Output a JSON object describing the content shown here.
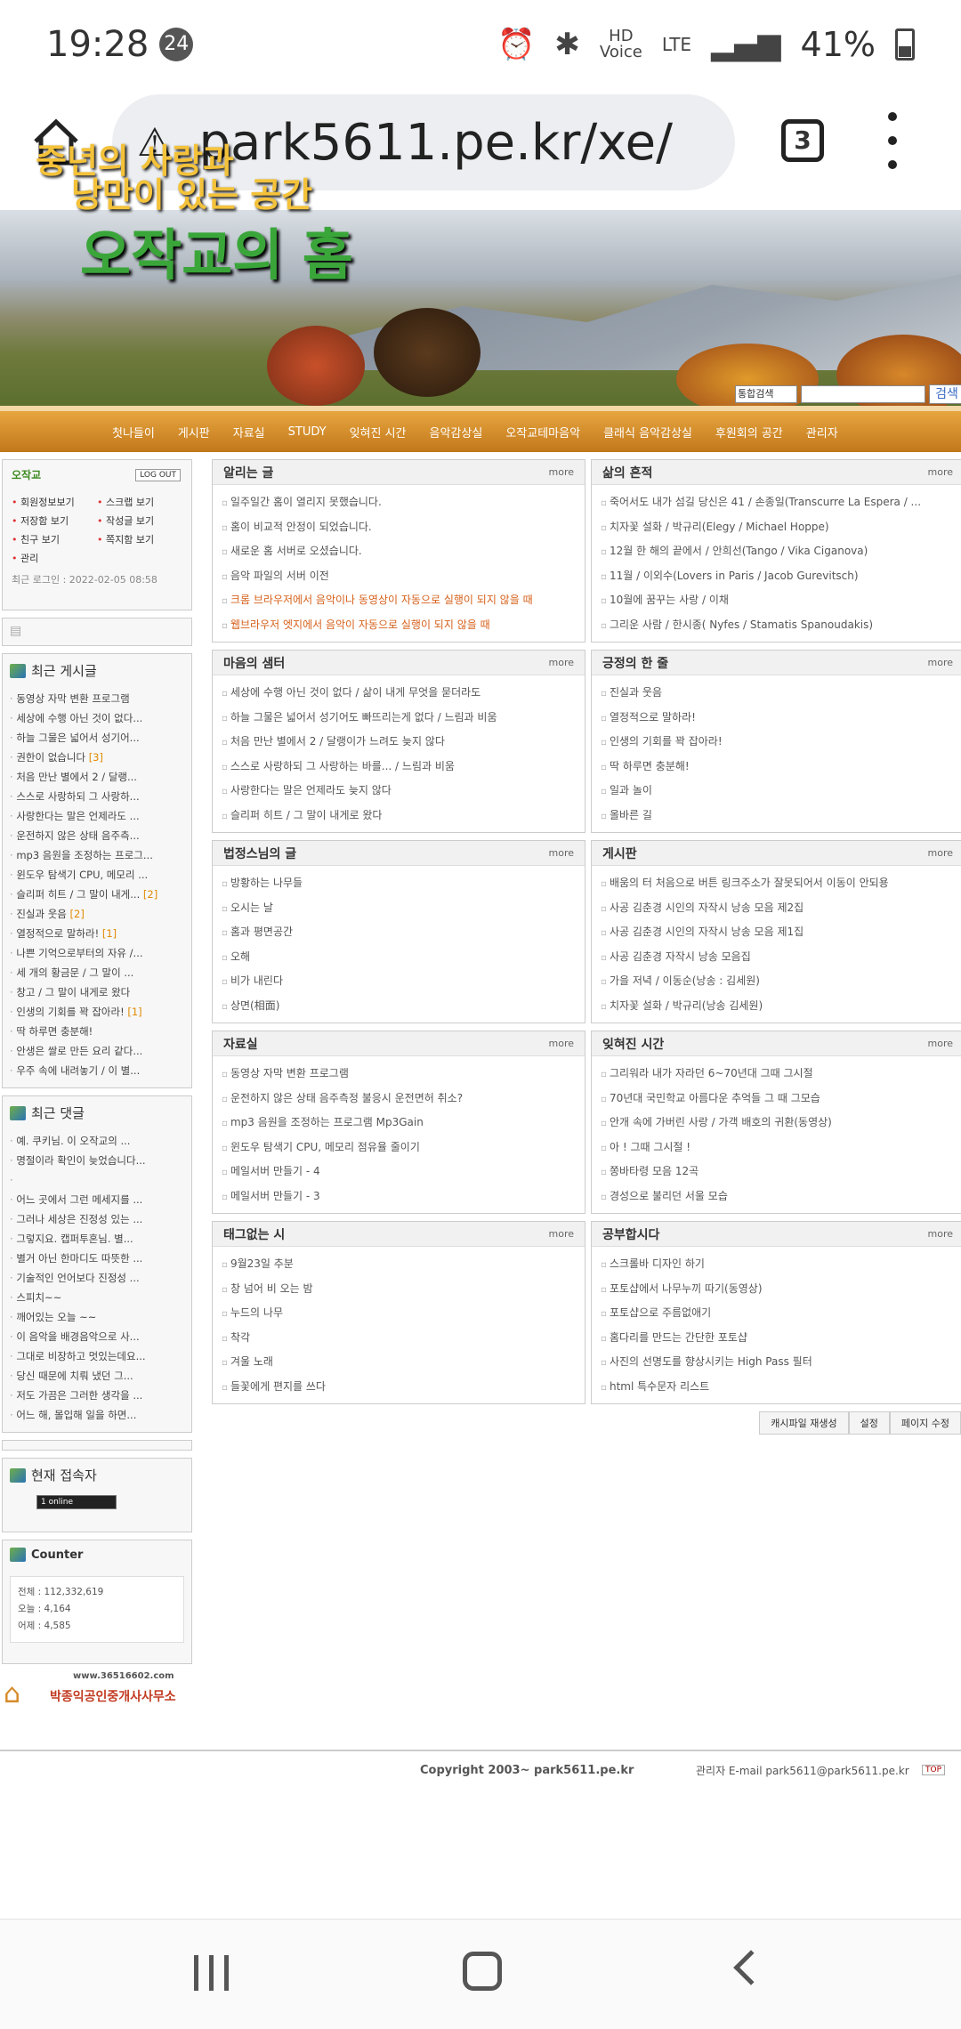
{
  "status": {
    "time": "19:28",
    "notif_count": "24",
    "net_label": "HD",
    "net_sub": "Voice",
    "lte": "LTE",
    "battery": "41%"
  },
  "browser": {
    "url": "park5611.pe.kr/xe/",
    "tabs": "3"
  },
  "banner": {
    "line1": "중년의 사랑과",
    "line2": "낭만이 있는 공간",
    "line3": "오작교의 홈",
    "search_select": "통합검색",
    "search_button": "검색"
  },
  "menu": [
    "첫나들이",
    "게시판",
    "자료실",
    "STUDY",
    "잊혀진 시간",
    "음악감상실",
    "오작교테마음악",
    "클래식 음악감상실",
    "후원회의 공간",
    "관리자"
  ],
  "login": {
    "name": "오작교",
    "logout": "LOG OUT",
    "links": [
      "회원정보보기",
      "스크랩 보기",
      "저장함 보기",
      "작성글 보기",
      "친구 보기",
      "쪽지함 보기",
      "관리"
    ],
    "last_login": "최근 로그인 : 2022-02-05 08:58"
  },
  "recent_posts": {
    "title": "최근 게시글",
    "items": [
      {
        "text": "동영상 자막 변환 프로그램",
        "count": ""
      },
      {
        "text": "세상에 수행 아닌 것이 없다...",
        "count": ""
      },
      {
        "text": "하늘 그물은 넓어서 성기어...",
        "count": ""
      },
      {
        "text": "권한이 없습니다",
        "count": "[3]"
      },
      {
        "text": "처음 만난 별에서 2 / 달랭...",
        "count": ""
      },
      {
        "text": "스스로 사랑하되 그 사랑하...",
        "count": ""
      },
      {
        "text": "사랑한다는 말은 언제라도 ...",
        "count": ""
      },
      {
        "text": "운전하지 않은 상태 음주측...",
        "count": ""
      },
      {
        "text": "mp3 음원을 조정하는 프로그...",
        "count": ""
      },
      {
        "text": "윈도우 탐색기 CPU, 메모리 ...",
        "count": ""
      },
      {
        "text": "슬리퍼 히트 / 그 말이 내게...",
        "count": "[2]"
      },
      {
        "text": "진실과 웃음",
        "count": "[2]"
      },
      {
        "text": "열정적으로 말하라!",
        "count": "[1]"
      },
      {
        "text": "나쁜 기억으로부터의 자유 /...",
        "count": ""
      },
      {
        "text": "세 개의 황금문 / 그 말이 ...",
        "count": ""
      },
      {
        "text": "창고 / 그 말이 내게로 왔다",
        "count": ""
      },
      {
        "text": "인생의 기회를 꽉 잡아라!",
        "count": "[1]"
      },
      {
        "text": "딱 하루면 충분해!",
        "count": ""
      },
      {
        "text": "안생은 쌀로 만든 요리 같다...",
        "count": ""
      },
      {
        "text": "우주 속에 내려놓기 / 이 별...",
        "count": ""
      }
    ]
  },
  "recent_comments": {
    "title": "최근 댓글",
    "items": [
      "예. 쿠키님. 이 오작교의 ...",
      "명절이라 확인이 늦었습니다...",
      "",
      "어느 곳에서 그런 메세지를 ...",
      "그러나 세상은 진정성 있는 ...",
      "그렇지요. 캡퍼투혼님. 별...",
      "별거 아닌 한마디도 따뜻한 ...",
      "기술적인 언어보다 진정성 ...",
      "스피치~~",
      "깨어있는 오늘 ~~",
      "이 음악을 배경음악으로 사...",
      "그대로 비장하고 멋있는데요...",
      "당신 때문에 치뤄 냈던 그...",
      "저도 가끔은 그러한 생각을 ...",
      "어느 해, 몰입해 일을 하면..."
    ]
  },
  "visitors": {
    "title": "현재 접속자",
    "online": "1 online"
  },
  "counter": {
    "title": "Counter",
    "total": "전체 : 112,332,619",
    "today": "오늘 : 4,164",
    "yesterday": "어제 : 4,585"
  },
  "ad": {
    "url": "www.36516602.com",
    "name": "박종익공인중개사사무소"
  },
  "boards": [
    {
      "title": "알리는 글",
      "more": "more",
      "items": [
        {
          "text": "일주일간 홈이 열리지 못했습니다.",
          "hl": false
        },
        {
          "text": "홈이 비교적 안정이 되었습니다.",
          "hl": false
        },
        {
          "text": "새로운 홈 서버로 오셨습니다.",
          "hl": false
        },
        {
          "text": "음악 파일의 서버 이전",
          "hl": false
        },
        {
          "text": "크롬 브라우저에서 음악이나 동영상이 자동으로 실행이 되지 않을 때",
          "hl": true
        },
        {
          "text": "웹브라우저 엣지에서 음악이 자동으로 실행이 되지 않을 때",
          "hl": true
        }
      ]
    },
    {
      "title": "삶의 흔적",
      "more": "more",
      "items": [
        {
          "text": "죽어서도 내가 섬길 당신은 41 / 손종일(Transcurre La Espera / ...",
          "hl": false
        },
        {
          "text": "치자꽃 설화 / 박규리(Elegy / Michael Hoppe)",
          "hl": false
        },
        {
          "text": "12월 한 해의 끝에서 / 안희선(Tango / Vika Ciganova)",
          "hl": false
        },
        {
          "text": "11월 / 이외수(Lovers in Paris / Jacob Gurevitsch)",
          "hl": false
        },
        {
          "text": "10월에 꿈꾸는 사랑 / 이채",
          "hl": false
        },
        {
          "text": "그리운 사람 / 한시종( Nyfes / Stamatis Spanoudakis)",
          "hl": false
        }
      ]
    },
    {
      "title": "마음의 샘터",
      "more": "more",
      "items": [
        {
          "text": "세상에 수행 아닌 것이 없다 / 삶이 내게 무엇을 묻더라도",
          "hl": false
        },
        {
          "text": "하늘 그물은 넓어서 성기어도 빠뜨리는게 없다 / 느림과 비움",
          "hl": false
        },
        {
          "text": "처음 만난 별에서 2 / 달랭이가 느려도 늦지 않다",
          "hl": false
        },
        {
          "text": "스스로 사랑하되 그 사랑하는 바를... / 느림과 비움",
          "hl": false
        },
        {
          "text": "사랑한다는 말은 언제라도 늦지 않다",
          "hl": false
        },
        {
          "text": "슬리퍼 히트 / 그 말이 내게로 왔다",
          "hl": false
        }
      ]
    },
    {
      "title": "긍정의 한 줄",
      "more": "more",
      "items": [
        {
          "text": "진실과 웃음",
          "hl": false
        },
        {
          "text": "열정적으로 말하라!",
          "hl": false
        },
        {
          "text": "인생의 기회를 꽉 잡아라!",
          "hl": false
        },
        {
          "text": "딱 하루면 충분해!",
          "hl": false
        },
        {
          "text": "일과 놀이",
          "hl": false
        },
        {
          "text": "올바른 길",
          "hl": false
        }
      ]
    },
    {
      "title": "법정스님의 글",
      "more": "more",
      "items": [
        {
          "text": "방황하는 나무들",
          "hl": false
        },
        {
          "text": "오시는 날",
          "hl": false
        },
        {
          "text": "홈과 평면공간",
          "hl": false
        },
        {
          "text": "오해",
          "hl": false
        },
        {
          "text": "비가 내린다",
          "hl": false
        },
        {
          "text": "상면(相面)",
          "hl": false
        }
      ]
    },
    {
      "title": "게시판",
      "more": "more",
      "items": [
        {
          "text": "배움의 터 처음으로 버튼 링크주소가 잘못되어서 이동이 안되용",
          "hl": false
        },
        {
          "text": "사공 김춘경 시인의 자작시 낭송 모음 제2집",
          "hl": false
        },
        {
          "text": "사공 김춘경 시인의 자작시 낭송 모음 제1집",
          "hl": false
        },
        {
          "text": "사공 김춘경 자작시 낭송 모음집",
          "hl": false
        },
        {
          "text": "가을 저녁 / 이동순(낭송 : 김세원)",
          "hl": false
        },
        {
          "text": "치자꽃 설화 / 박규리(낭송 김세원)",
          "hl": false
        }
      ]
    },
    {
      "title": "자료실",
      "more": "more",
      "items": [
        {
          "text": "동영상 자막 변환 프로그램",
          "hl": false
        },
        {
          "text": "운전하지 않은 상태 음주측정 불응시 운전면허 취소?",
          "hl": false
        },
        {
          "text": "mp3 음원을 조정하는 프로그램 Mp3Gain",
          "hl": false
        },
        {
          "text": "윈도우 탐색기 CPU, 메모리 점유율 줄이기",
          "hl": false
        },
        {
          "text": "메일서버 만들기 - 4",
          "hl": false
        },
        {
          "text": "메일서버 만들기 - 3",
          "hl": false
        }
      ]
    },
    {
      "title": "잊혀진 시간",
      "more": "more",
      "items": [
        {
          "text": "그리워라 내가 자라던 6~70년대 그때 그시절",
          "hl": false
        },
        {
          "text": "70년대 국민학교 아름다운 추억들 그 때 그모습",
          "hl": false
        },
        {
          "text": "안개 속에 가버린 사랑 / 가객 배호의 귀환(동영상)",
          "hl": false
        },
        {
          "text": "아 ! 그때 그시절 !",
          "hl": false
        },
        {
          "text": "쫑바타령 모음 12곡",
          "hl": false
        },
        {
          "text": "경성으로 불리던 서울 모습",
          "hl": false
        }
      ]
    },
    {
      "title": "태그없는 시",
      "more": "more",
      "items": [
        {
          "text": "9월23일 추분",
          "hl": false
        },
        {
          "text": "창 넘어 비 오는 밤",
          "hl": false
        },
        {
          "text": "누드의 나무",
          "hl": false
        },
        {
          "text": "착각",
          "hl": false
        },
        {
          "text": "겨울 노래",
          "hl": false
        },
        {
          "text": "들꽃에게 편지를 쓰다",
          "hl": false
        }
      ]
    },
    {
      "title": "공부합시다",
      "more": "more",
      "items": [
        {
          "text": "스크롤바 디자인 하기",
          "hl": false
        },
        {
          "text": "포토샵에서 나무누끼 따기(동영상)",
          "hl": false
        },
        {
          "text": "포토샵으로 주름없애기",
          "hl": false
        },
        {
          "text": "홈다리를 만드는 간단한 포토샵",
          "hl": false
        },
        {
          "text": "사진의 선명도를 향상시키는 High Pass 필터",
          "hl": false
        },
        {
          "text": "html 특수문자 리스트",
          "hl": false
        }
      ]
    }
  ],
  "admin_buttons": [
    "캐시파일 재생성",
    "설정",
    "페이지 수정"
  ],
  "footer": {
    "copyright": "Copyright 2003~ park5611.pe.kr",
    "admin_email": "관리자 E-mail park5611@park5611.pe.kr",
    "top": "TOP"
  }
}
